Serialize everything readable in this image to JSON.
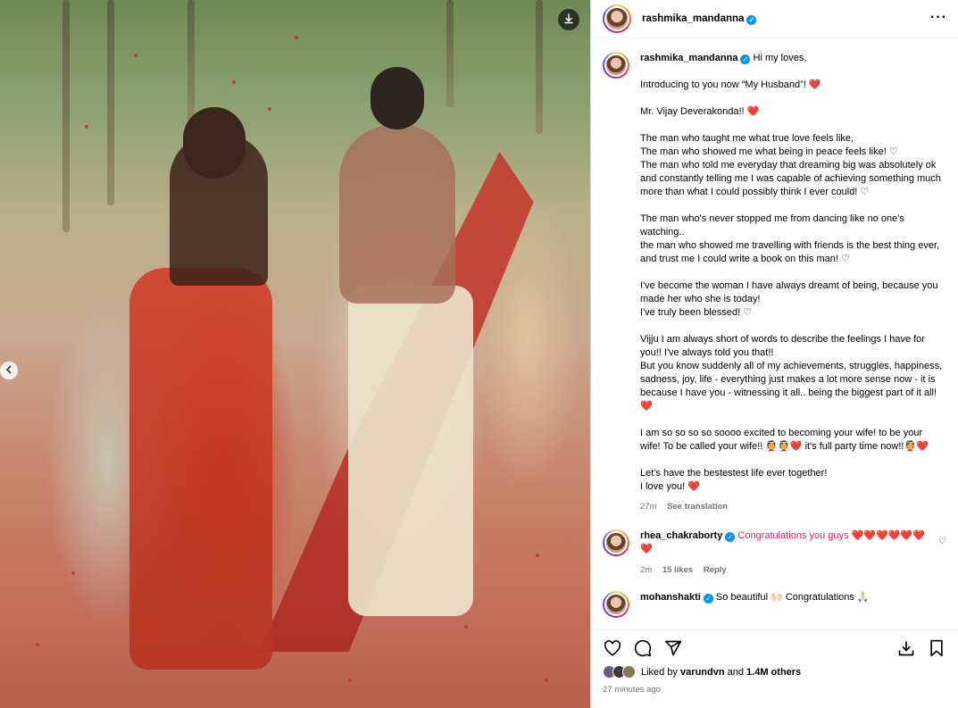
{
  "post": {
    "username": "rashmika_mandanna",
    "verified": true,
    "more_icon": "more-horizontal-icon",
    "download_icon": "download-icon",
    "carousel_prev_icon": "chevron-left-icon"
  },
  "caption": {
    "username": "rashmika_mandanna",
    "greeting": "Hi my loves,",
    "paragraphs": [
      "Introducing to you now “My Husband”! ❤️",
      "Mr. Vijay Deverakonda!! ❤️",
      "The man who taught me what true love feels like,\nThe man who showed me what being in peace feels like! ♡\nThe man who told me everyday that dreaming big was absolutely ok and constantly telling me I was capable of achieving something much more than what I could possibly think I ever could! ♡",
      "The man who's never stopped me from dancing like no one's watching..\nthe man who showed me travelling with friends is the best thing ever, and trust me I could write a book on this man! ♡",
      "I've become the woman I have always dreamt of being, because you made her who she is today!\nI've truly been blessed! ♡",
      "Vijju I am always short of words to describe the feelings I have for you!! I've always told you that!!\nBut you know suddenly all of my achievements, struggles, happiness, sadness, joy, life - everything just makes a lot more sense now - it is because I have you - witnessing it all.. being the biggest part of it all! ❤️",
      "I am so so so so soooo excited to becoming your wife! to be your wife! To be called your wife!! 👰👰❤️ it's full party time now!!👰❤️",
      "Let's have the bestestest life ever together!\nI love you! ❤️"
    ],
    "time_ago": "27m",
    "see_translation": "See translation"
  },
  "comments": [
    {
      "username": "rhea_chakraborty",
      "verified": true,
      "text": "Congratulations you guys ❤️❤️❤️❤️❤️❤️❤️",
      "time_ago": "2m",
      "likes": "15 likes",
      "reply": "Reply"
    },
    {
      "username": "mohanshakti",
      "verified": true,
      "text": "So beautiful 🙌🏻 Congratulations 🙏🏻"
    }
  ],
  "actions": {
    "like_icon": "heart-icon",
    "comment_icon": "comment-icon",
    "share_icon": "send-icon",
    "save_share_icon": "share-to-icon",
    "bookmark_icon": "bookmark-icon"
  },
  "likes": {
    "prefix": "Liked by",
    "user": "varundvn",
    "and": "and",
    "others": "1.4M others"
  },
  "posted": "27 minutes ago"
}
